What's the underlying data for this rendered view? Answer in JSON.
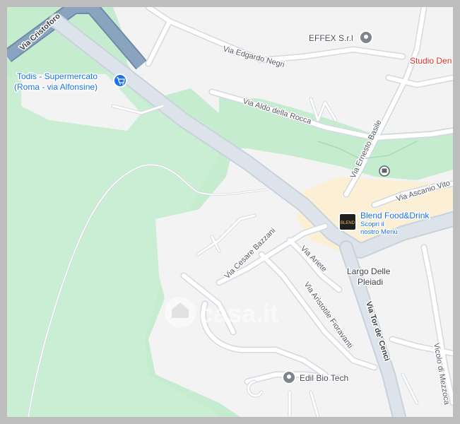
{
  "map": {
    "colors": {
      "background": "#f3f3f3",
      "park": "#c6eccf",
      "park_light": "#d9f2df",
      "commercial": "#fbefd6",
      "road": "#ffffff",
      "road_casing": "#d4d9e0",
      "main_road": "#d6dde6",
      "highway": "#8aa4bf",
      "poi_blue": "#1a73e8",
      "poi_gray": "#5f6368",
      "poi_red": "#d93025"
    },
    "streets": {
      "via_cristoforo": "Via Cristoforo",
      "via_edgardo_negri": "Via Edgardo Negri",
      "via_aldo_della_rocca": "Via Aldo della Rocca",
      "via_ernesto_basile": "Via Ernesto Basile",
      "via_ascanio_vito": "Via Ascanio Vito",
      "via_cesare_bazzani": "Via Cesare Bazzani",
      "via_ariete": "Via Ariete",
      "via_aristotile_fioravanti": "Via Aristotile Fioravanti",
      "via_tor_de_cenci": "Via Tor de' Cenci",
      "vicolo_di_mezzocammino": "Vicolo di Mezzoca"
    },
    "pois": {
      "todis": {
        "name_line1": "Todis - Supermercato",
        "name_line2": "(Roma - via Alfonsine)",
        "icon": "shopping-cart-icon"
      },
      "effex": {
        "name": "EFFEX S.r.l",
        "icon": "place-pin-icon"
      },
      "studio": {
        "name": "Studio Den"
      },
      "blend": {
        "name": "Blend Food&Drink",
        "sub_line1": "Scopri il",
        "sub_line2": "nostro Menù",
        "logo_text": "BLEND"
      },
      "edil_bio_tech": {
        "name": "Edil Bio Tech",
        "icon": "place-pin-icon"
      },
      "bus_stop": {
        "icon": "bus-stop-icon"
      }
    },
    "places": {
      "largo_line1": "Largo Delle",
      "largo_line2": "Pleiadi"
    },
    "watermark": {
      "text": "casa.it"
    }
  }
}
